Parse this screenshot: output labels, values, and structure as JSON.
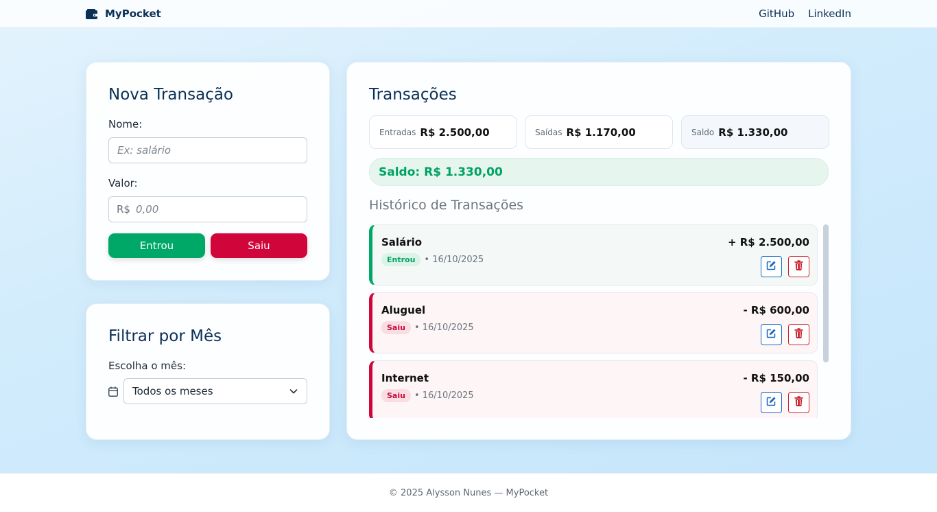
{
  "navbar": {
    "brand_icon": "wallet-icon",
    "brand": "MyPocket",
    "links": [
      "GitHub",
      "LinkedIn"
    ]
  },
  "new_transaction": {
    "title": "Nova Transação",
    "name_label": "Nome:",
    "name_placeholder": "Ex: salário",
    "value_label": "Valor:",
    "currency_prefix": "R$",
    "value_placeholder": "0,00",
    "in_button": "Entrou",
    "out_button": "Saiu"
  },
  "filter": {
    "title": "Filtrar por Mês",
    "label": "Escolha o mês:",
    "icon": "calendar-icon",
    "selected": "Todos os meses"
  },
  "transactions": {
    "title": "Transações",
    "summary": {
      "in_label": "Entradas",
      "in_value": "R$ 2.500,00",
      "out_label": "Saídas",
      "out_value": "R$ 1.170,00",
      "balance_label": "Saldo",
      "balance_value": "R$ 1.330,00"
    },
    "balance_banner": "Saldo: R$ 1.330,00",
    "history_title": "Histórico de Transações",
    "items": [
      {
        "name": "Salário",
        "type": "Entrou",
        "date": "• 16/10/2025",
        "amount": "+ R$ 2.500,00"
      },
      {
        "name": "Aluguel",
        "type": "Saiu",
        "date": "• 16/10/2025",
        "amount": "- R$ 600,00"
      },
      {
        "name": "Internet",
        "type": "Saiu",
        "date": "• 16/10/2025",
        "amount": "- R$ 150,00"
      }
    ]
  },
  "colors": {
    "primary_dark": "#0b2f55",
    "income": "#00a868",
    "expense": "#d0063a",
    "edit": "#1667c2",
    "delete": "#c9262f"
  },
  "footer": {
    "text": "© 2025 Alysson Nunes — MyPocket"
  }
}
